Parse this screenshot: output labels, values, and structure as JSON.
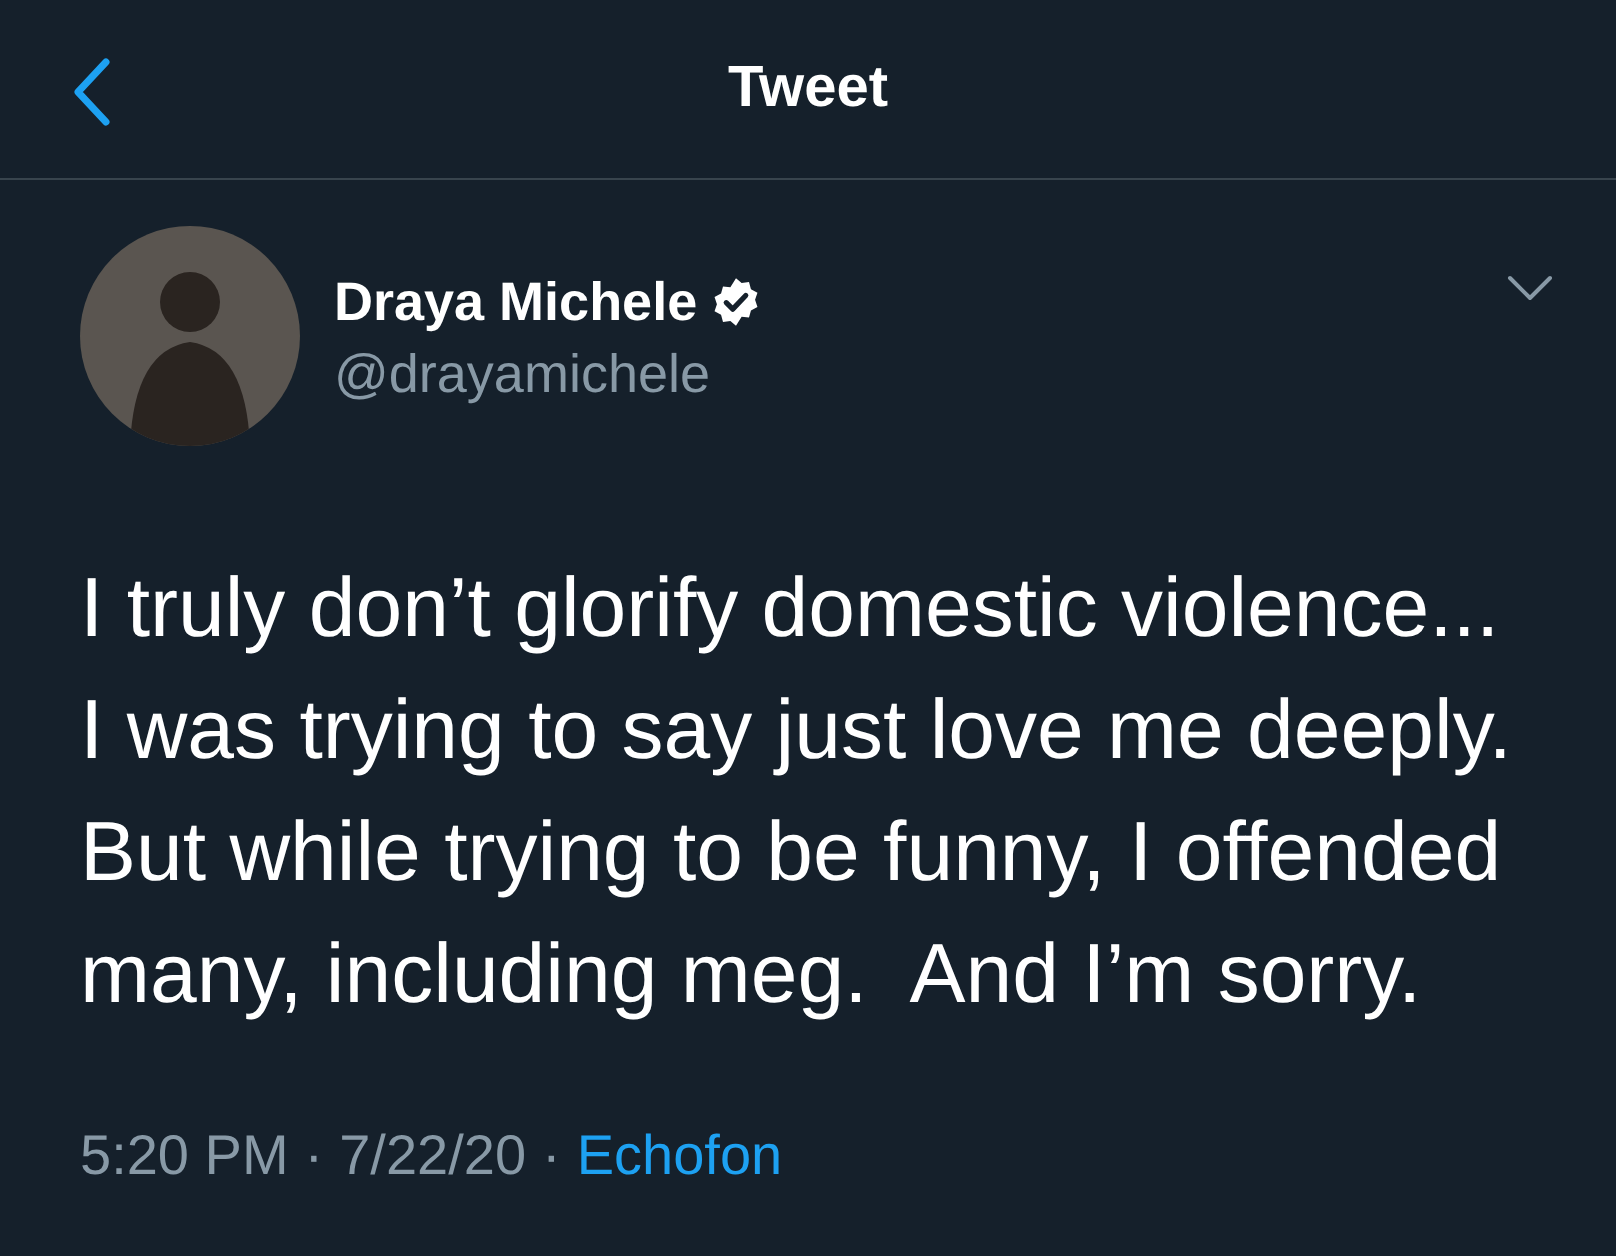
{
  "header": {
    "title": "Tweet"
  },
  "author": {
    "name": "Draya Michele",
    "verified": true,
    "handle": "@drayamichele"
  },
  "tweet": {
    "text": "I truly don’t glorify domestic violence...\nI was trying to say just love me deeply.\nBut while trying to be funny, I offended\nmany, including meg.  And I’m sorry."
  },
  "meta": [
    {
      "kind": "text",
      "text": "5:20 PM"
    },
    {
      "kind": "text",
      "text": "·"
    },
    {
      "kind": "text",
      "text": "7/22/20"
    },
    {
      "kind": "text",
      "text": "·"
    },
    {
      "kind": "link",
      "text": "Echofon"
    }
  ]
}
